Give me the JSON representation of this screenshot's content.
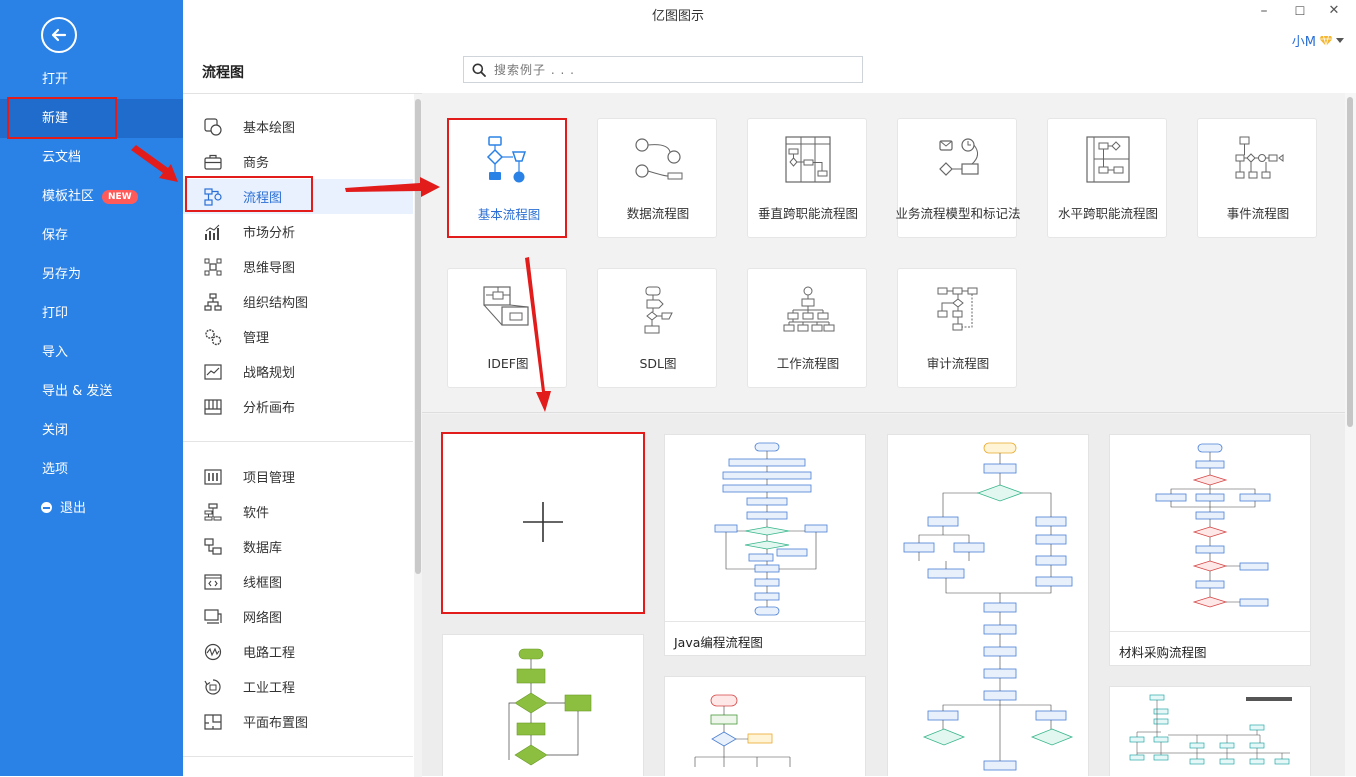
{
  "app": {
    "title": "亿图图示",
    "minimize": "–",
    "maximize": "☐",
    "close": "✕",
    "user": "小M"
  },
  "sidebar": {
    "items": [
      {
        "label": "打开"
      },
      {
        "label": "新建"
      },
      {
        "label": "云文档"
      },
      {
        "label": "模板社区",
        "badge": "NEW"
      },
      {
        "label": "保存"
      },
      {
        "label": "另存为"
      },
      {
        "label": "打印"
      },
      {
        "label": "导入"
      },
      {
        "label": "导出 & 发送"
      },
      {
        "label": "关闭"
      },
      {
        "label": "选项"
      },
      {
        "label": "退出"
      }
    ]
  },
  "header": {
    "section_title": "流程图",
    "search_placeholder": "搜索例子 . . ."
  },
  "categories": {
    "group1": [
      {
        "label": "基本绘图",
        "icon": "basic-shapes-icon"
      },
      {
        "label": "商务",
        "icon": "briefcase-icon"
      },
      {
        "label": "流程图",
        "icon": "flowchart-icon"
      },
      {
        "label": "市场分析",
        "icon": "bar-chart-icon"
      },
      {
        "label": "思维导图",
        "icon": "mindmap-icon"
      },
      {
        "label": "组织结构图",
        "icon": "org-chart-icon"
      },
      {
        "label": "管理",
        "icon": "gears-icon"
      },
      {
        "label": "战略规划",
        "icon": "strategy-icon"
      },
      {
        "label": "分析画布",
        "icon": "canvas-icon"
      }
    ],
    "group2": [
      {
        "label": "项目管理",
        "icon": "project-icon"
      },
      {
        "label": "软件",
        "icon": "software-icon"
      },
      {
        "label": "数据库",
        "icon": "database-icon"
      },
      {
        "label": "线框图",
        "icon": "wireframe-icon"
      },
      {
        "label": "网络图",
        "icon": "network-icon"
      },
      {
        "label": "电路工程",
        "icon": "circuit-icon"
      },
      {
        "label": "工业工程",
        "icon": "industrial-icon"
      },
      {
        "label": "平面布置图",
        "icon": "floorplan-icon"
      }
    ]
  },
  "diagram_types": [
    {
      "label": "基本流程图"
    },
    {
      "label": "数据流程图"
    },
    {
      "label": "垂直跨职能流程图"
    },
    {
      "label": "业务流程模型和标记法"
    },
    {
      "label": "水平跨职能流程图"
    },
    {
      "label": "事件流程图"
    },
    {
      "label": "IDEF图"
    },
    {
      "label": "SDL图"
    },
    {
      "label": "工作流程图"
    },
    {
      "label": "审计流程图"
    }
  ],
  "examples": [
    {
      "caption": "Java编程流程图"
    },
    {
      "caption": "材料采购流程图"
    }
  ],
  "colors": {
    "sidebar": "#2b82e6",
    "accent": "#2b6fd6",
    "annotation": "#e21b1b",
    "badge": "#ff5a5a"
  }
}
